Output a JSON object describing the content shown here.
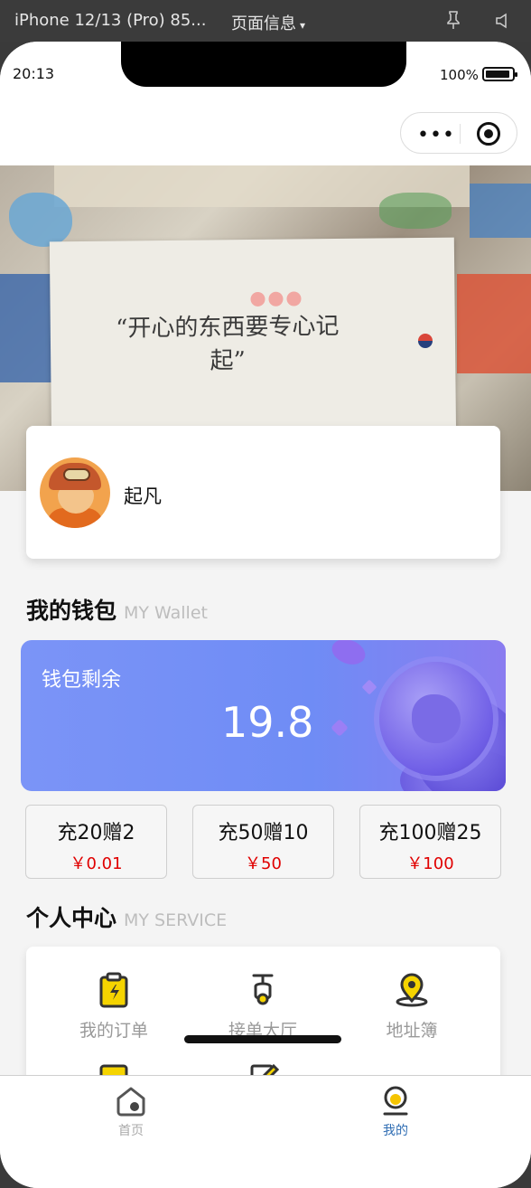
{
  "devtools": {
    "device": "iPhone 12/13 (Pro) 85...",
    "page_info": "页面信息",
    "caret": "▾",
    "pin_icon": "pin-icon",
    "speaker_icon": "speaker-icon"
  },
  "status_bar": {
    "time": "20:13",
    "battery": "100%"
  },
  "capsule": {
    "menu_icon": "more-dots-icon",
    "close_icon": "target-icon",
    "dots": "•••"
  },
  "banner": {
    "quote": "“开心的东西要专心记起”"
  },
  "profile": {
    "name": "起凡"
  },
  "wallet_section": {
    "title": "我的钱包",
    "subtitle": "MY Wallet"
  },
  "wallet": {
    "label": "钱包剩余",
    "amount": "19.8",
    "gradient_start": "#7b94f7",
    "gradient_end": "#8a7cf0"
  },
  "recharge_options": [
    {
      "title": "充20赠2",
      "price": "￥0.01"
    },
    {
      "title": "充50赠10",
      "price": "￥50"
    },
    {
      "title": "充100赠25",
      "price": "￥100"
    }
  ],
  "service_section": {
    "title": "个人中心",
    "subtitle": "MY SERVICE"
  },
  "services": [
    {
      "label": "我的订单",
      "icon": "clipboard-icon"
    },
    {
      "label": "接单大厅",
      "icon": "scooter-icon"
    },
    {
      "label": "地址簿",
      "icon": "location-pin-icon"
    }
  ],
  "tabbar": {
    "items": [
      {
        "label": "首页",
        "icon": "home-icon",
        "active": false
      },
      {
        "label": "我的",
        "icon": "profile-icon",
        "active": true
      }
    ],
    "active_color": "#2f6db3",
    "inactive_color": "#aaaaaa"
  },
  "colors": {
    "price_red": "#e00000",
    "icon_yellow": "#f5d400"
  }
}
